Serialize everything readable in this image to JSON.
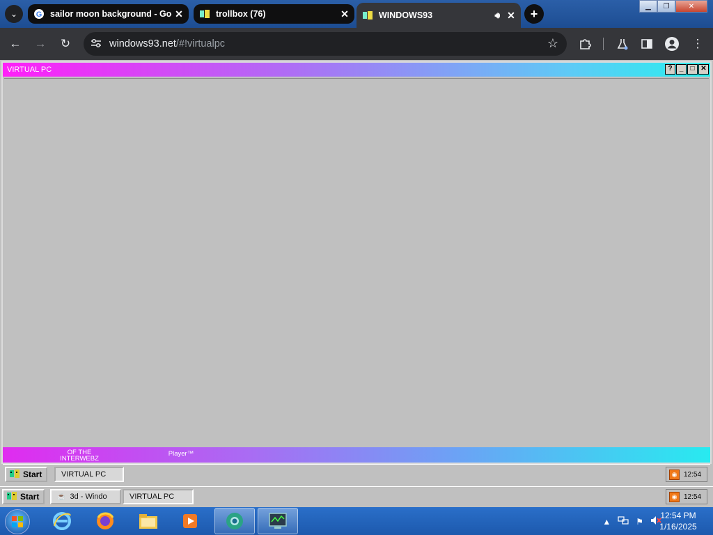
{
  "browser": {
    "tabs": [
      {
        "title": "sailor moon background - Goo",
        "favicon": "google-g-icon"
      },
      {
        "title": "trollbox (76)",
        "favicon": "w93-icon"
      },
      {
        "title": "WINDOWS93",
        "favicon": "w93-icon",
        "active": true
      }
    ],
    "url_host": "windows93.net",
    "url_path": "/#!virtualpc"
  },
  "w93_window": {
    "title": "VIRTUAL PC",
    "bottom_text_1": "OF THE INTERWEBZ",
    "bottom_text_2": "Player™"
  },
  "inner_taskbar": {
    "start_label": "Start",
    "task_label": "VIRTUAL PC",
    "clock": "12:54"
  },
  "outer_taskbar": {
    "start_label": "Start",
    "task1_label": "3d - Windo",
    "task2_label": "VIRTUAL PC",
    "clock": "12:54"
  },
  "win7": {
    "time": "12:54 PM",
    "date": "1/16/2025"
  }
}
